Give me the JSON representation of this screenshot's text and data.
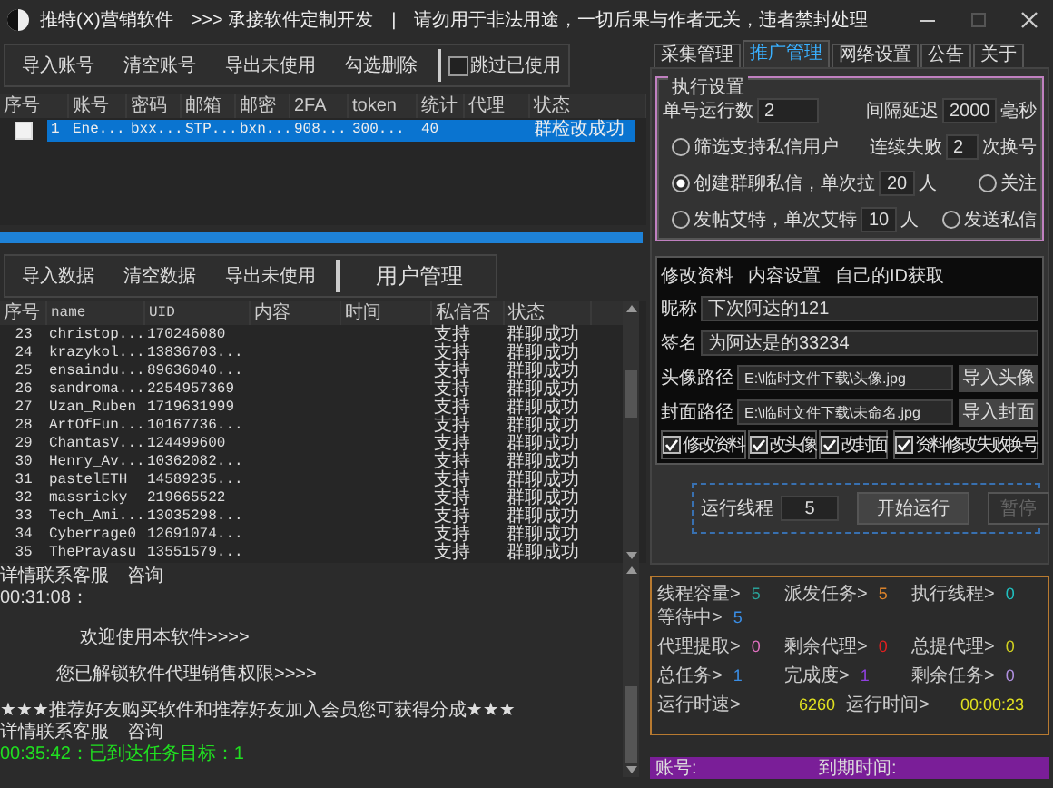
{
  "window": {
    "title": "推特(X)营销软件　>>> 承接软件定制开发　|　请勿用于非法用途，一切后果与作者无关，违者禁封处理"
  },
  "toolbar": {
    "buttons": [
      "导入账号",
      "清空账号",
      "导出未使用",
      "勾选删除"
    ],
    "skip_used": {
      "label": "跳过已使用",
      "checked": false
    }
  },
  "accounts": {
    "columns": [
      "序号",
      "账号",
      "密码",
      "邮箱",
      "邮密",
      "2FA",
      "token",
      "统计",
      "代理",
      "状态"
    ],
    "rows": [
      {
        "checked": false,
        "selected": true,
        "cells": [
          "1",
          "Ene...",
          "bxx...",
          "STP...",
          "bxn...",
          "908...",
          "300...",
          "40",
          "",
          "群检改成功"
        ]
      }
    ]
  },
  "progress": {
    "level": 1
  },
  "data_toolbar": {
    "buttons": [
      "导入数据",
      "清空数据",
      "导出未使用"
    ],
    "user_management": "用户管理"
  },
  "users": {
    "columns": [
      "序号",
      "name",
      "UID",
      "内容",
      "时间",
      "私信否",
      "状态"
    ],
    "rows": [
      {
        "cells": [
          "23",
          "christop...",
          "170246080",
          "",
          "",
          "支持",
          "群聊成功"
        ]
      },
      {
        "cells": [
          "24",
          "krazykol...",
          "13836703...",
          "",
          "",
          "支持",
          "群聊成功"
        ]
      },
      {
        "cells": [
          "25",
          "ensaindu...",
          "89636040...",
          "",
          "",
          "支持",
          "群聊成功"
        ]
      },
      {
        "cells": [
          "26",
          "sandroma...",
          "2254957369",
          "",
          "",
          "支持",
          "群聊成功"
        ]
      },
      {
        "cells": [
          "27",
          "Uzan_Ruben",
          "1719631999",
          "",
          "",
          "支持",
          "群聊成功"
        ]
      },
      {
        "cells": [
          "28",
          "ArtOfFun...",
          "10167736...",
          "",
          "",
          "支持",
          "群聊成功"
        ]
      },
      {
        "cells": [
          "29",
          "ChantasV...",
          "124499600",
          "",
          "",
          "支持",
          "群聊成功"
        ]
      },
      {
        "cells": [
          "30",
          "Henry_Av...",
          "10362082...",
          "",
          "",
          "支持",
          "群聊成功"
        ]
      },
      {
        "cells": [
          "31",
          "pastelETH",
          "14589235...",
          "",
          "",
          "支持",
          "群聊成功"
        ]
      },
      {
        "cells": [
          "32",
          "massricky",
          "219665522",
          "",
          "",
          "支持",
          "群聊成功"
        ]
      },
      {
        "cells": [
          "33",
          "Tech_Ami...",
          "13035298...",
          "",
          "",
          "支持",
          "群聊成功"
        ]
      },
      {
        "cells": [
          "34",
          "Cyberrage0",
          "12691074...",
          "",
          "",
          "支持",
          "群聊成功"
        ]
      },
      {
        "cells": [
          "35",
          "ThePrayasu",
          "13551579...",
          "",
          "",
          "支持",
          "群聊成功"
        ]
      }
    ]
  },
  "log": [
    {
      "kind": "plain",
      "text": "详情联系客服　咨询"
    },
    {
      "kind": "plain",
      "text": "00:31:08："
    },
    {
      "kind": "welcome",
      "text": "欢迎使用本软件>>>>"
    },
    {
      "kind": "notice",
      "text": "您已解锁软件代理销售权限>>>>"
    },
    {
      "kind": "plain",
      "text": "★★★推荐好友购买软件和推荐好友加入会员您可获得分成★★★"
    },
    {
      "kind": "plain",
      "text": "详情联系客服　咨询"
    },
    {
      "kind": "success",
      "text": "00:35:42：已到达任务目标：1"
    }
  ],
  "tabs": [
    {
      "label": "采集管理",
      "selected": false
    },
    {
      "label": "推广管理",
      "selected": true
    },
    {
      "label": "网络设置",
      "selected": false
    },
    {
      "label": "公告",
      "selected": false
    },
    {
      "label": "关于",
      "selected": false
    }
  ],
  "exec_settings": {
    "title": "执行设置",
    "run_count": {
      "label": "单号运行数",
      "value": "2"
    },
    "interval": {
      "label": "间隔延迟",
      "value": "2000",
      "unit": "毫秒"
    },
    "fail_switch": {
      "label": "连续失败",
      "value": "2",
      "unit": "次换号"
    },
    "modes": [
      {
        "label": "筛选支持私信用户",
        "selected": false
      },
      {
        "label": "创建群聊私信，单次拉",
        "value": "20",
        "unit": "人",
        "selected": true
      },
      {
        "label": "发帖艾特，单次艾特",
        "value": "10",
        "unit": "人",
        "selected": false
      }
    ],
    "actions": [
      {
        "label": "关注",
        "selected": false
      },
      {
        "label": "发送私信",
        "selected": false
      }
    ]
  },
  "profile": {
    "links": [
      "修改资料",
      "内容设置",
      "自己的ID获取"
    ],
    "nickname": {
      "label": "昵称",
      "value": "下次阿达的121"
    },
    "signature": {
      "label": "签名",
      "value": "为阿达是的33234"
    },
    "paths": [
      {
        "label": "头像路径",
        "value": "E:\\临时文件下载\\头像.jpg",
        "button": "导入头像"
      },
      {
        "label": "封面路径",
        "value": "E:\\临时文件下载\\未命名.jpg",
        "button": "导入封面"
      }
    ],
    "options": [
      {
        "label": "修改资料",
        "checked": true
      },
      {
        "label": "改头像",
        "checked": true
      },
      {
        "label": "改封面",
        "checked": true
      },
      {
        "label": "资料修改失败换号",
        "checked": true
      }
    ]
  },
  "run": {
    "threads": {
      "label": "运行线程",
      "value": "5"
    },
    "start": "开始运行",
    "pause": {
      "label": "暂停",
      "disabled": true
    }
  },
  "stats": [
    [
      {
        "label": "线程容量>",
        "value": "5",
        "color": "#2aa198"
      },
      {
        "label": "派发任务>",
        "value": "5",
        "color": "#d9822b"
      },
      {
        "label": "执行线程>",
        "value": "0",
        "color": "#20c0c0"
      }
    ],
    [
      {
        "label": "等待中>",
        "value": "5",
        "color": "#3a8ee6"
      }
    ],
    [
      {
        "label": "代理提取>",
        "value": "0",
        "color": "#e070c0"
      },
      {
        "label": "剩余代理>",
        "value": "0",
        "color": "#e02020"
      },
      {
        "label": "总提代理>",
        "value": "0",
        "color": "#d0d020"
      }
    ],
    [
      {
        "label": "总任务>",
        "value": "1",
        "color": "#3a8ee6"
      },
      {
        "label": "完成度>",
        "value": "1",
        "color": "#9040e0"
      },
      {
        "label": "剩余任务>",
        "value": "0",
        "color": "#b090e0"
      }
    ],
    [
      {
        "label": "运行时速>",
        "value": "6260",
        "color": "#e0e020"
      },
      {
        "label": "运行时间>",
        "value": "00:00:23",
        "color": "#e0e020"
      }
    ]
  ],
  "footer": {
    "account": "账号:",
    "expiry": "到期时间:"
  }
}
